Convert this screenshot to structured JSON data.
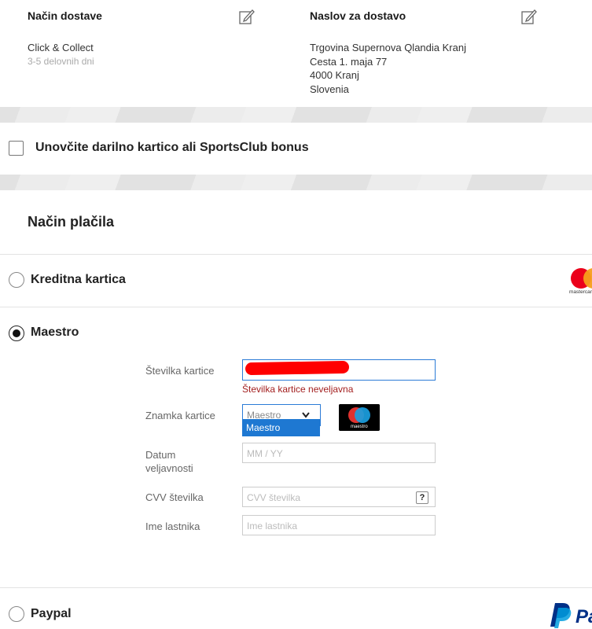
{
  "delivery": {
    "method_title": "Način dostave",
    "method_name": "Click & Collect",
    "method_time": "3-5 delovnih dni",
    "address_title": "Naslov za dostavo",
    "address_lines": [
      "Trgovina Supernova Qlandia Kranj",
      "Cesta 1. maja 77",
      "4000 Kranj",
      "Slovenia"
    ]
  },
  "gift_card": {
    "label": "Unovčite darilno kartico ali SportsClub bonus",
    "checked": false
  },
  "payment": {
    "title": "Način plačila",
    "methods": [
      {
        "label": "Kreditna kartica",
        "selected": false,
        "logo": "mastercard-logo"
      },
      {
        "label": "Maestro",
        "selected": true,
        "logo": "maestro-logo"
      },
      {
        "label": "Paypal",
        "selected": false,
        "logo": "paypal-logo"
      }
    ]
  },
  "maestro_form": {
    "card_number_label": "Številka kartice",
    "card_number_error": "Številka kartice neveljavna",
    "card_brand_label": "Znamka kartice",
    "card_brand_selected": "Maestro",
    "card_brand_options": [
      "Maestro"
    ],
    "expiry_label_line1": "Datum",
    "expiry_label_line2": "veljavnosti",
    "expiry_placeholder": "MM / YY",
    "cvv_label": "CVV številka",
    "cvv_placeholder": "CVV številka",
    "cvv_help": "?",
    "owner_label": "Ime lastnika",
    "owner_placeholder": "Ime lastnika",
    "maestro_logo_text": "maestro"
  },
  "logos": {
    "mastercard_text": "mastercard",
    "paypal_text": "Pa"
  },
  "colors": {
    "error": "#a32020",
    "focus_border": "#2b7bd6",
    "dropdown_highlight": "#1e78d2"
  }
}
